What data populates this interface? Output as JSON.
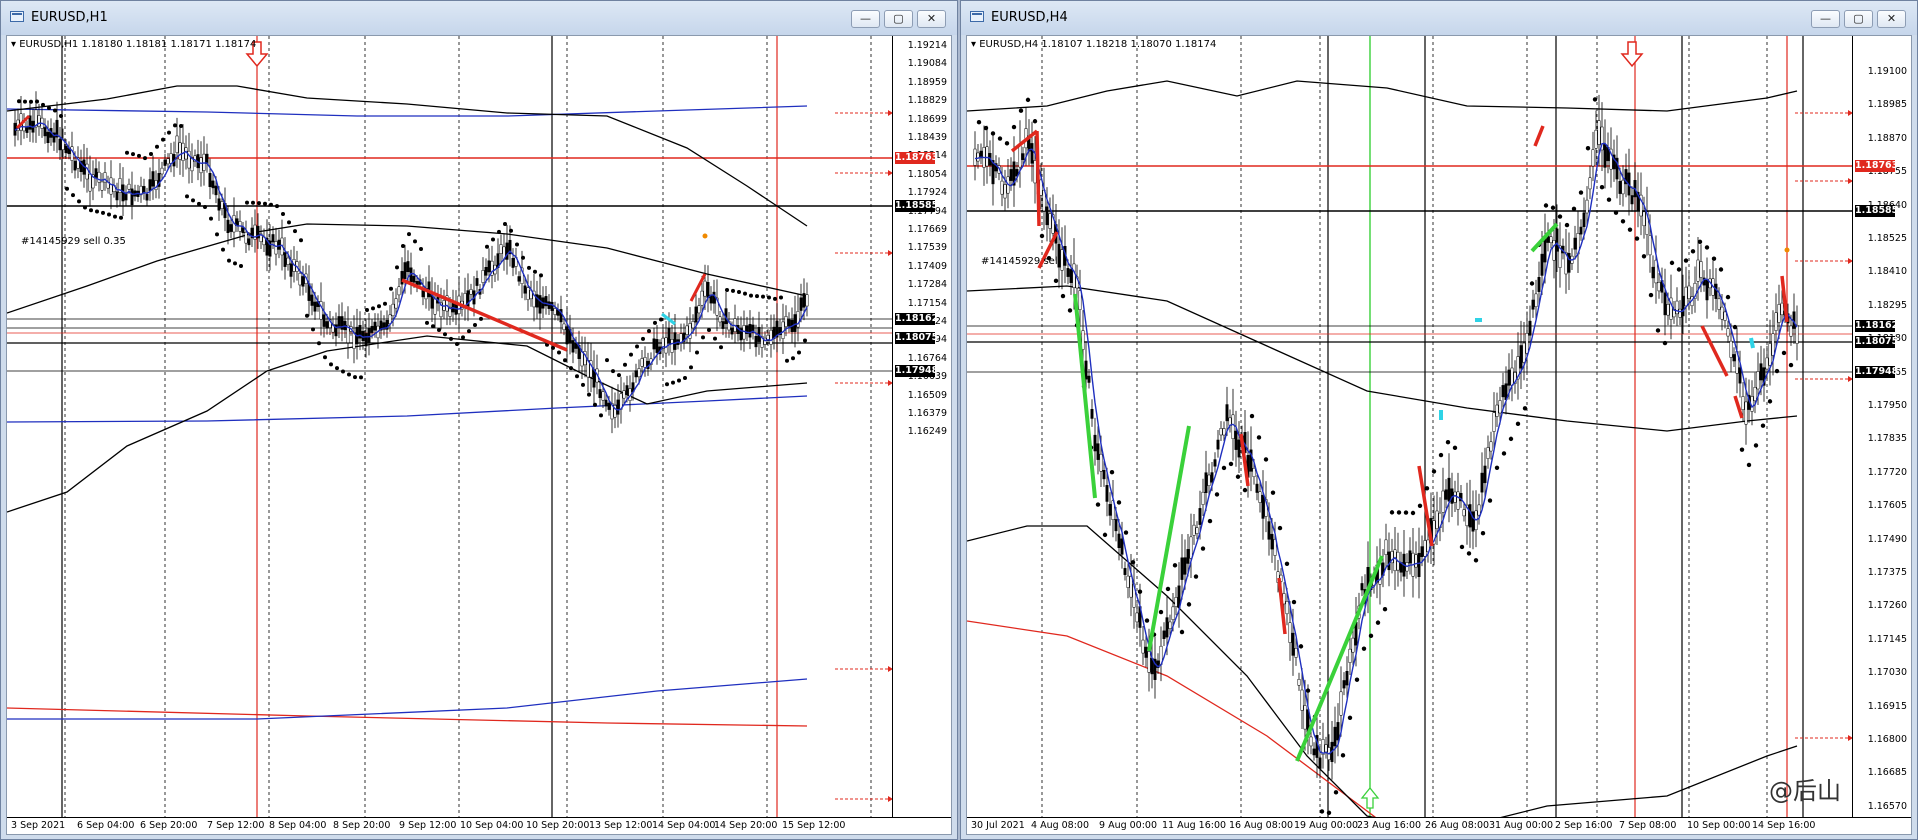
{
  "left": {
    "title": "EURUSD,H1",
    "header": "EURUSD,H1  1.18180 1.18181 1.18171 1.18174",
    "label": "#14145929 sell 0.35",
    "prices": [
      "1.19214",
      "1.19084",
      "1.18959",
      "1.18829",
      "1.18699",
      "1.18439",
      "1.18314",
      "1.18054",
      "1.17924",
      "1.17794",
      "1.17669",
      "1.17539",
      "1.17409",
      "1.17284",
      "1.17154",
      "1.17024",
      "1.16894",
      "1.16764",
      "1.16639",
      "1.16509",
      "1.16379",
      "1.16249"
    ],
    "tags": [
      {
        "text": "1.18763",
        "color": "#e0281e"
      },
      {
        "text": "1.18585",
        "color": "#000000"
      },
      {
        "text": "1.18162",
        "color": "#000000"
      },
      {
        "text": "1.18075",
        "color": "#000000"
      },
      {
        "text": "1.17948",
        "color": "#000000"
      }
    ],
    "times": [
      "3 Sep 2021",
      "6 Sep 04:00",
      "6 Sep 20:00",
      "7 Sep 12:00",
      "8 Sep 04:00",
      "8 Sep 20:00",
      "9 Sep 12:00",
      "10 Sep 04:00",
      "10 Sep 20:00",
      "13 Sep 12:00",
      "14 Sep 04:00",
      "14 Sep 20:00",
      "15 Sep 12:00"
    ]
  },
  "right": {
    "title": "EURUSD,H4",
    "header": "EURUSD,H4  1.18107 1.18218 1.18070 1.18174",
    "label": "#14145929 sell",
    "prices": [
      "1.19100",
      "1.18985",
      "1.18870",
      "1.18755",
      "1.18640",
      "1.18525",
      "1.18410",
      "1.18295",
      "1.18180",
      "1.18065",
      "1.17950",
      "1.17835",
      "1.17720",
      "1.17605",
      "1.17490",
      "1.17375",
      "1.17260",
      "1.17145",
      "1.17030",
      "1.16915",
      "1.16800",
      "1.16685",
      "1.16570"
    ],
    "tags": [
      {
        "text": "1.18763",
        "color": "#e0281e"
      },
      {
        "text": "1.18585",
        "color": "#000000"
      },
      {
        "text": "1.18162",
        "color": "#000000"
      },
      {
        "text": "1.18075",
        "color": "#000000"
      },
      {
        "text": "1.17948",
        "color": "#000000"
      }
    ],
    "times": [
      "30 Jul 2021",
      "4 Aug 08:00",
      "9 Aug 00:00",
      "11 Aug 16:00",
      "16 Aug 08:00",
      "19 Aug 00:00",
      "23 Aug 16:00",
      "26 Aug 08:00",
      "31 Aug 00:00",
      "2 Sep 16:00",
      "7 Sep 08:00",
      "10 Sep 00:00",
      "14 Sep 16:00"
    ],
    "watermark": "@后山"
  },
  "buttons": {
    "minimize": "—",
    "maximize": "▢",
    "close": "✕"
  }
}
